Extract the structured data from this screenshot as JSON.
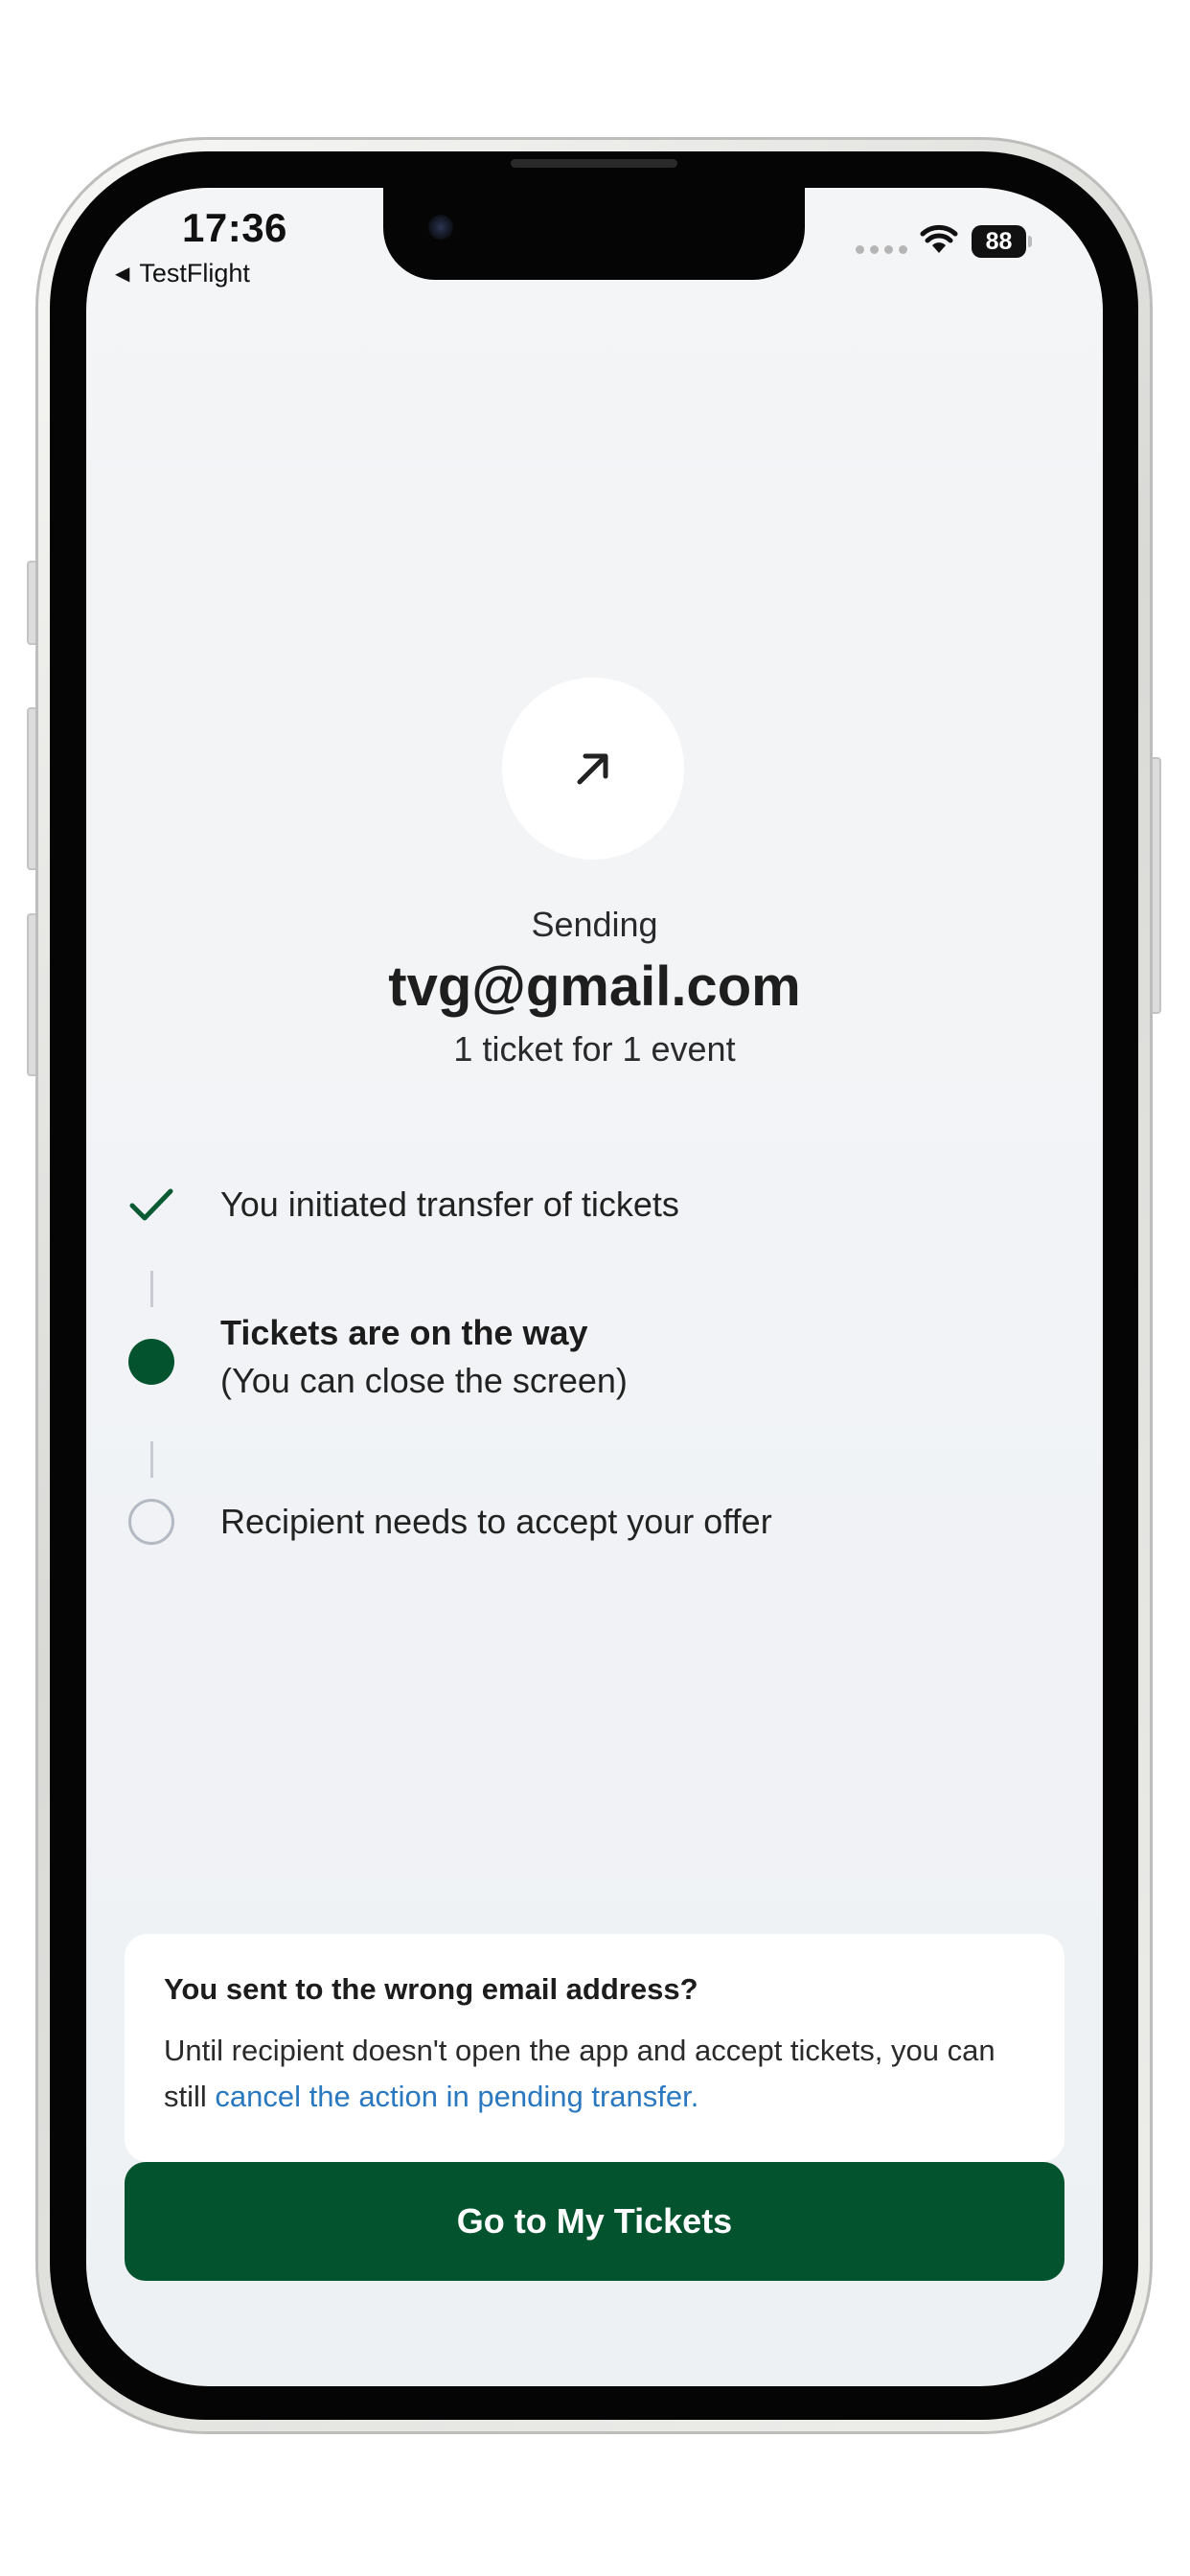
{
  "status_bar": {
    "time": "17:36",
    "back_app": "TestFlight",
    "battery": "88"
  },
  "transfer": {
    "icon": "arrow-up-right-icon",
    "status_label": "Sending",
    "recipient_email": "tvg@gmail.com",
    "summary": "1 ticket for 1 event"
  },
  "steps": [
    {
      "label": "You initiated transfer of tickets",
      "state": "done",
      "icon": "checkmark-icon"
    },
    {
      "label": "Tickets are on the way",
      "sublabel": "(You can close the screen)",
      "state": "active",
      "icon": "filled-dot-icon"
    },
    {
      "label": "Recipient needs to accept your offer",
      "state": "pending",
      "icon": "empty-circle-icon"
    }
  ],
  "info_card": {
    "title": "You sent to the wrong email address?",
    "body": "Until recipient doesn't open the app and accept tickets, you can still ",
    "link": "cancel the action in pending transfer."
  },
  "primary_button": {
    "label": "Go to My Tickets"
  },
  "colors": {
    "brand_green": "#03542e",
    "link_blue": "#2a78c0",
    "screen_bg": "#eef1f4"
  }
}
